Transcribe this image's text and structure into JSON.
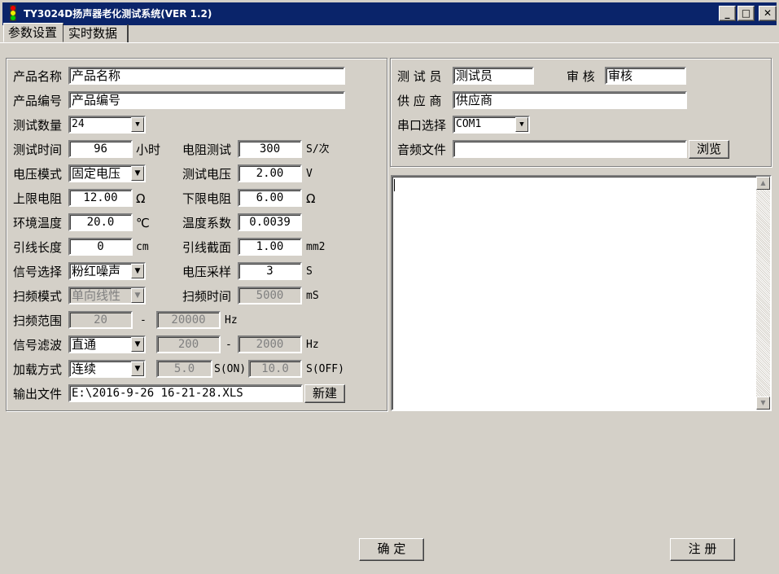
{
  "window": {
    "title": "TY3024D扬声器老化测试系统(VER 1.2)",
    "min": "_",
    "max": "□",
    "close": "✕"
  },
  "tabs": [
    "参数设置",
    "实时数据"
  ],
  "left": {
    "product_name": {
      "label": "产品名称",
      "value": "产品名称"
    },
    "product_code": {
      "label": "产品编号",
      "value": "产品编号"
    },
    "test_count": {
      "label": "测试数量",
      "value": "24"
    },
    "test_time": {
      "label": "测试时间",
      "value": "96",
      "unit": "小时"
    },
    "res_test": {
      "label": "电阻测试",
      "value": "300",
      "unit": "S/次"
    },
    "voltage_mode": {
      "label": "电压模式",
      "value": "固定电压"
    },
    "test_voltage": {
      "label": "测试电压",
      "value": "2.00",
      "unit": "V"
    },
    "upper_res": {
      "label": "上限电阻",
      "value": "12.00",
      "unit": "Ω"
    },
    "lower_res": {
      "label": "下限电阻",
      "value": "6.00",
      "unit": "Ω"
    },
    "env_temp": {
      "label": "环境温度",
      "value": "20.0",
      "unit": "℃"
    },
    "temp_coef": {
      "label": "温度系数",
      "value": "0.0039"
    },
    "lead_len": {
      "label": "引线长度",
      "value": "0",
      "unit": "cm"
    },
    "lead_area": {
      "label": "引线截面",
      "value": "1.00",
      "unit": "mm2"
    },
    "signal": {
      "label": "信号选择",
      "value": "粉红噪声"
    },
    "v_sample": {
      "label": "电压采样",
      "value": "3",
      "unit": "S"
    },
    "sweep_mode": {
      "label": "扫频模式",
      "value": "单向线性"
    },
    "sweep_time": {
      "label": "扫频时间",
      "value": "5000",
      "unit": "mS"
    },
    "sweep_range": {
      "label": "扫频范围",
      "from": "20",
      "dash": "-",
      "to": "20000",
      "unit": "Hz"
    },
    "filter": {
      "label": "信号滤波",
      "value": "直通",
      "from": "200",
      "dash": "-",
      "to": "2000",
      "unit": "Hz"
    },
    "load": {
      "label": "加载方式",
      "value": "连续",
      "on": "5.0",
      "on_unit": "S(ON)",
      "off": "10.0",
      "off_unit": "S(OFF)"
    },
    "output": {
      "label": "输出文件",
      "value": "E:\\2016-9-26 16-21-28.XLS",
      "button": "新建"
    }
  },
  "right": {
    "tester": {
      "label": "测 试 员",
      "value": "测试员"
    },
    "reviewer": {
      "label": "审  核",
      "value": "审核"
    },
    "supplier": {
      "label": "供 应 商",
      "value": "供应商"
    },
    "port": {
      "label": "串口选择",
      "value": "COM1"
    },
    "audio": {
      "label": "音频文件",
      "value": "",
      "button": "浏览"
    }
  },
  "buttons": {
    "ok": "确 定",
    "register": "注 册"
  }
}
